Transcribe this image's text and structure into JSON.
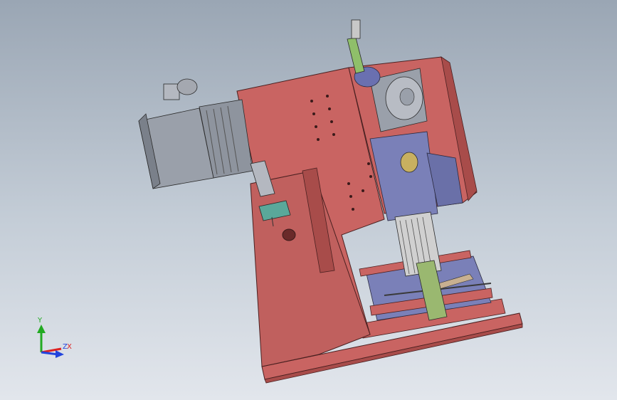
{
  "viewport": {
    "background_top": "#9aa6b4",
    "background_bottom": "#e2e6ec"
  },
  "model": {
    "frame_color": "#c96462",
    "frame_dark": "#a84c4a",
    "housing_color": "#7a80b8",
    "motor_color": "#9aa0aa",
    "accent_green": "#8fbf6a",
    "teal_block": "#5aa89a"
  },
  "triad": {
    "y_label": "Y",
    "z_label": "Z",
    "x_label": "X",
    "y_color": "#22aa22",
    "x_color": "#dd2222",
    "z_color": "#2244dd"
  }
}
